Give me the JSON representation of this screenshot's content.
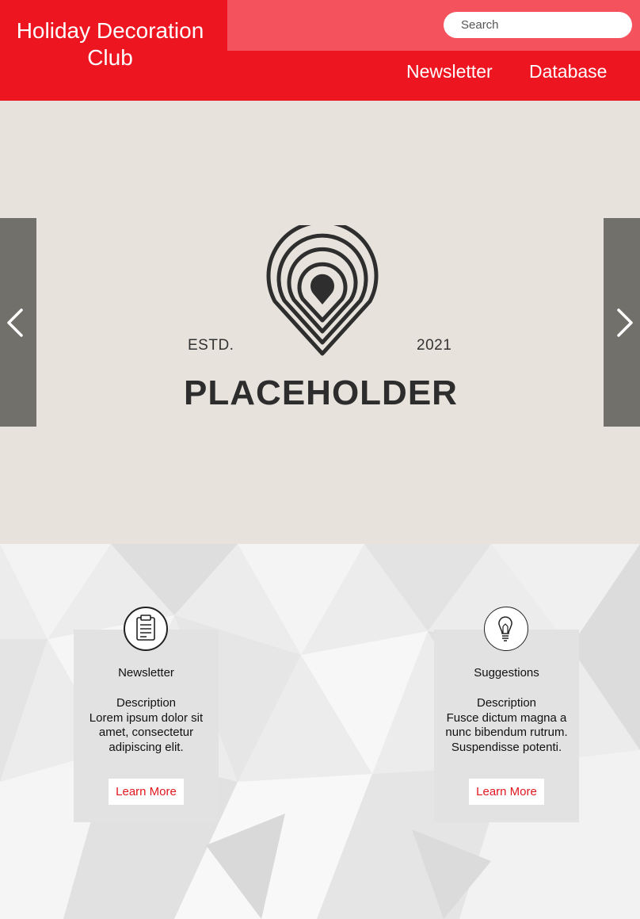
{
  "header": {
    "title": "Holiday Decoration Club",
    "search_placeholder": "Search",
    "nav": [
      "Newsletter",
      "Database"
    ]
  },
  "hero": {
    "estd": "ESTD.",
    "year": "2021",
    "brand": "PLACEHOLDER",
    "icons": {
      "prev": "chevron-left-icon",
      "next": "chevron-right-icon",
      "logo": "location-pin-icon"
    }
  },
  "cards": [
    {
      "title": "Newsletter",
      "icon": "clipboard-icon",
      "desc_heading": "Description",
      "desc": "Lorem ipsum dolor sit amet, consectetur adipiscing elit.",
      "button": "Learn More"
    },
    {
      "title": "Suggestions",
      "icon": "lightbulb-icon",
      "desc_heading": "Description",
      "desc": "Fusce dictum magna a nunc bibendum rutrum. Suspendisse potenti.",
      "button": "Learn More"
    }
  ],
  "colors": {
    "header_red": "#ec1520",
    "header_pink": "#f4525c",
    "hero_bg": "#e7e3dc",
    "arrow_bg": "#71706b",
    "link_red": "#e0161f"
  }
}
